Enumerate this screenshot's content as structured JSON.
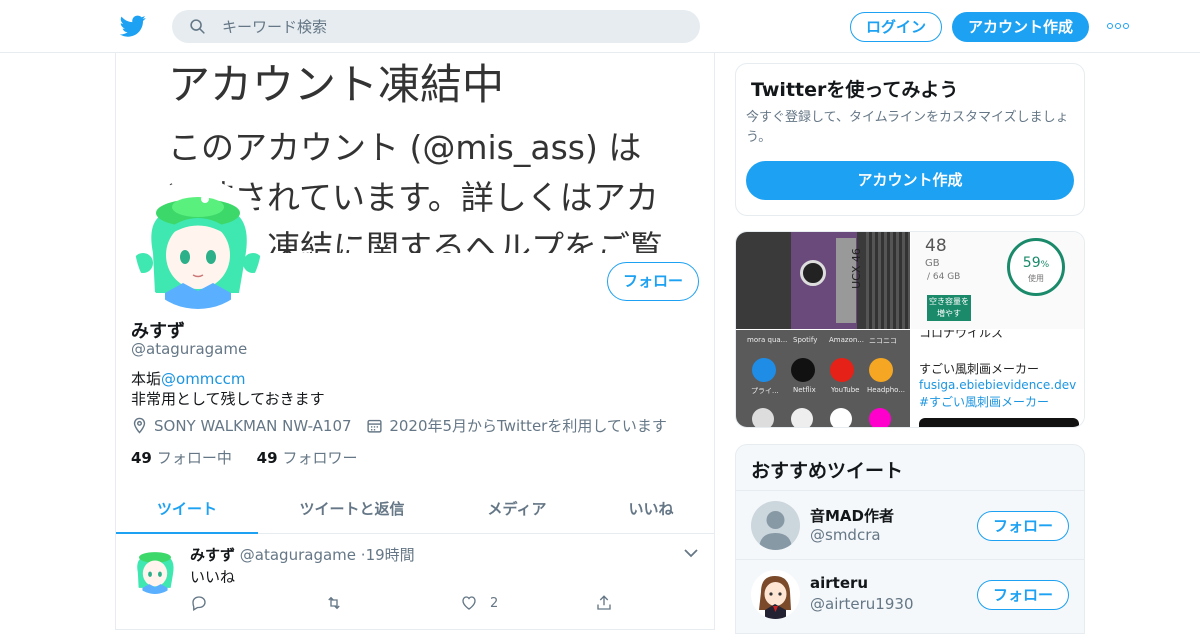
{
  "header": {
    "search_placeholder": "キーワード検索",
    "login_label": "ログイン",
    "signup_label": "アカウント作成"
  },
  "banner": {
    "title": "アカウント凍結中",
    "body": "このアカウント (@mis_ass) は凍結されています。詳しくはアカウント凍結に関するヘルプをご覧"
  },
  "profile": {
    "follow_label": "フォロー",
    "name": "みすず",
    "handle": "@ataguragame",
    "bio_prefix": "本垢",
    "bio_mention": "@ommccm",
    "bio_line2": "非常用として残しておきます",
    "location": "SONY WALKMAN NW-A107",
    "joined": "2020年5月からTwitterを利用しています",
    "following_count": "49",
    "following_label": "フォロー中",
    "followers_count": "49",
    "followers_label": "フォロワー"
  },
  "tabs": [
    "ツイート",
    "ツイートと返信",
    "メディア",
    "いいね"
  ],
  "tweet": {
    "name": "みすず",
    "handle": "@ataguragame",
    "time": "19時間",
    "text": "いいね",
    "like_count": "2"
  },
  "signup_card": {
    "title": "Twitterを使ってみよう",
    "desc": "今すぐ登録して、タイムラインをカスタマイズしましょう。",
    "button": "アカウント作成"
  },
  "media": {
    "storage_gb": "48",
    "storage_unit": "GB",
    "storage_total": "/ 64 GB",
    "storage_pct": "59",
    "storage_pct_label": "使用",
    "storage_button": "空き容量を増やす",
    "cassette_label": "UCX 46",
    "apps": [
      "mora qua...",
      "Spotify",
      "Amazon...",
      "ニコニコ",
      "プライ...",
      "Netflix",
      "YouTube",
      "Headpho..."
    ],
    "text_top": "コロナウイルス",
    "text_title": "すごい風刺画メーカー",
    "text_link": "fusiga.ebiebievidence.dev #すごい風刺画メーカー"
  },
  "recommend": {
    "title": "おすすめツイート",
    "users": [
      {
        "name": "音MAD作者",
        "handle": "@smdcra",
        "button": "フォロー"
      },
      {
        "name": "airteru",
        "handle": "@airteru1930",
        "button": "フォロー"
      }
    ]
  },
  "colors": {
    "accent": "#1da1f2",
    "link": "#1b95e0",
    "muted": "#657786"
  }
}
